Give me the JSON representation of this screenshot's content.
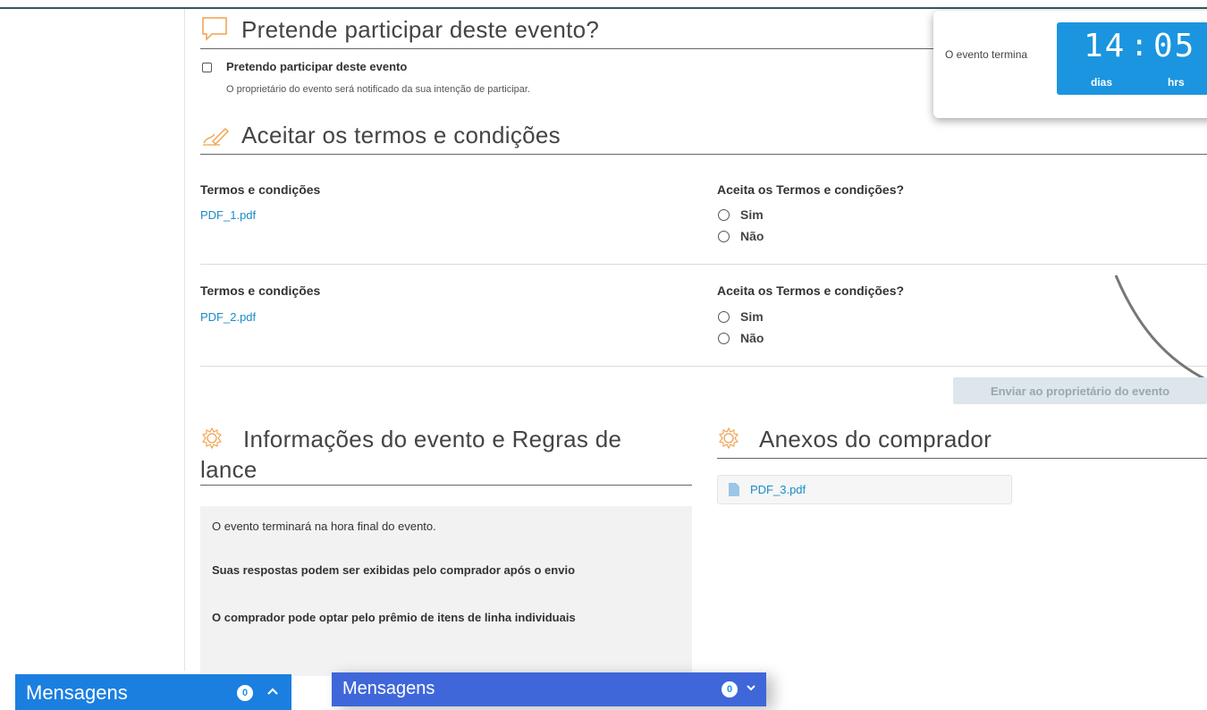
{
  "participate": {
    "title": "Pretende participar deste evento?",
    "checkbox_label": "Pretendo participar deste evento",
    "note": "O proprietário do evento será notificado da sua intenção de participar."
  },
  "timer": {
    "label": "O evento termina",
    "days_value": "14",
    "separator": ":",
    "hours_value": "05",
    "days_unit": "dias",
    "hours_unit": "hrs"
  },
  "terms": {
    "title": "Aceitar os termos e condições",
    "items": [
      {
        "header": "Termos e condições",
        "file": "PDF_1.pdf",
        "question": "Aceita os Termos e condições?",
        "yes": "Sim",
        "no": "Não"
      },
      {
        "header": "Termos e condições",
        "file": "PDF_2.pdf",
        "question": "Aceita os Termos e condições?",
        "yes": "Sim",
        "no": "Não"
      }
    ],
    "send_button": "Enviar ao proprietário do evento"
  },
  "event_info": {
    "title_line1": "Informações do evento e Regras de",
    "title_line2": "lance",
    "text1": "O evento terminará na hora final do evento.",
    "text2": "Suas respostas podem ser exibidas pelo comprador após o envio",
    "text3": "O comprador pode optar pelo prêmio de itens de linha individuais"
  },
  "buyer_attachments": {
    "title": "Anexos do comprador",
    "file": "PDF_3.pdf"
  },
  "messages": [
    {
      "label": "Mensagens",
      "count": "0"
    },
    {
      "label": "Mensagens",
      "count": "0"
    }
  ],
  "colors": {
    "accent_orange": "#f0a04b",
    "link_blue": "#1a8cc9",
    "timer_blue": "#1b95e0",
    "message_bar_blue": "#1b7fe0",
    "message_bar_blue_2": "#3f67d9"
  }
}
